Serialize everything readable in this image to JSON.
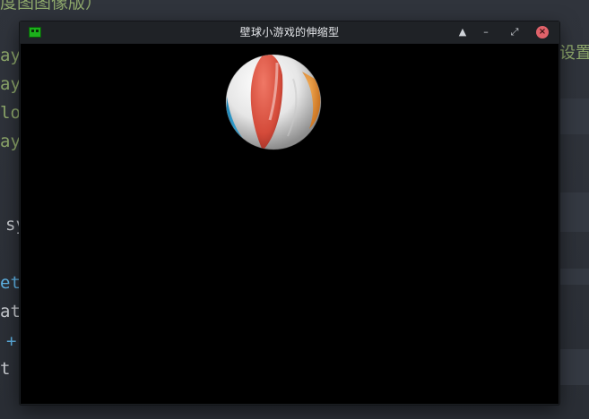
{
  "background_editor": {
    "fragments": [
      "设置",
      "ay",
      "ay",
      "lo",
      "ay",
      "sy",
      "et(",
      "ath",
      "+",
      "t"
    ],
    "top_line": "度图图像版）"
  },
  "window": {
    "title": "壁球小游戏的伸缩型",
    "app_icon": "creeper-icon",
    "buttons": {
      "eject": "▲",
      "minimize": "–",
      "maximize": "⤢",
      "close": "×"
    },
    "colors": {
      "canvas_background": "#000000",
      "close_button": "#e0626a"
    }
  },
  "game": {
    "sprite": "beach-ball-icon"
  }
}
